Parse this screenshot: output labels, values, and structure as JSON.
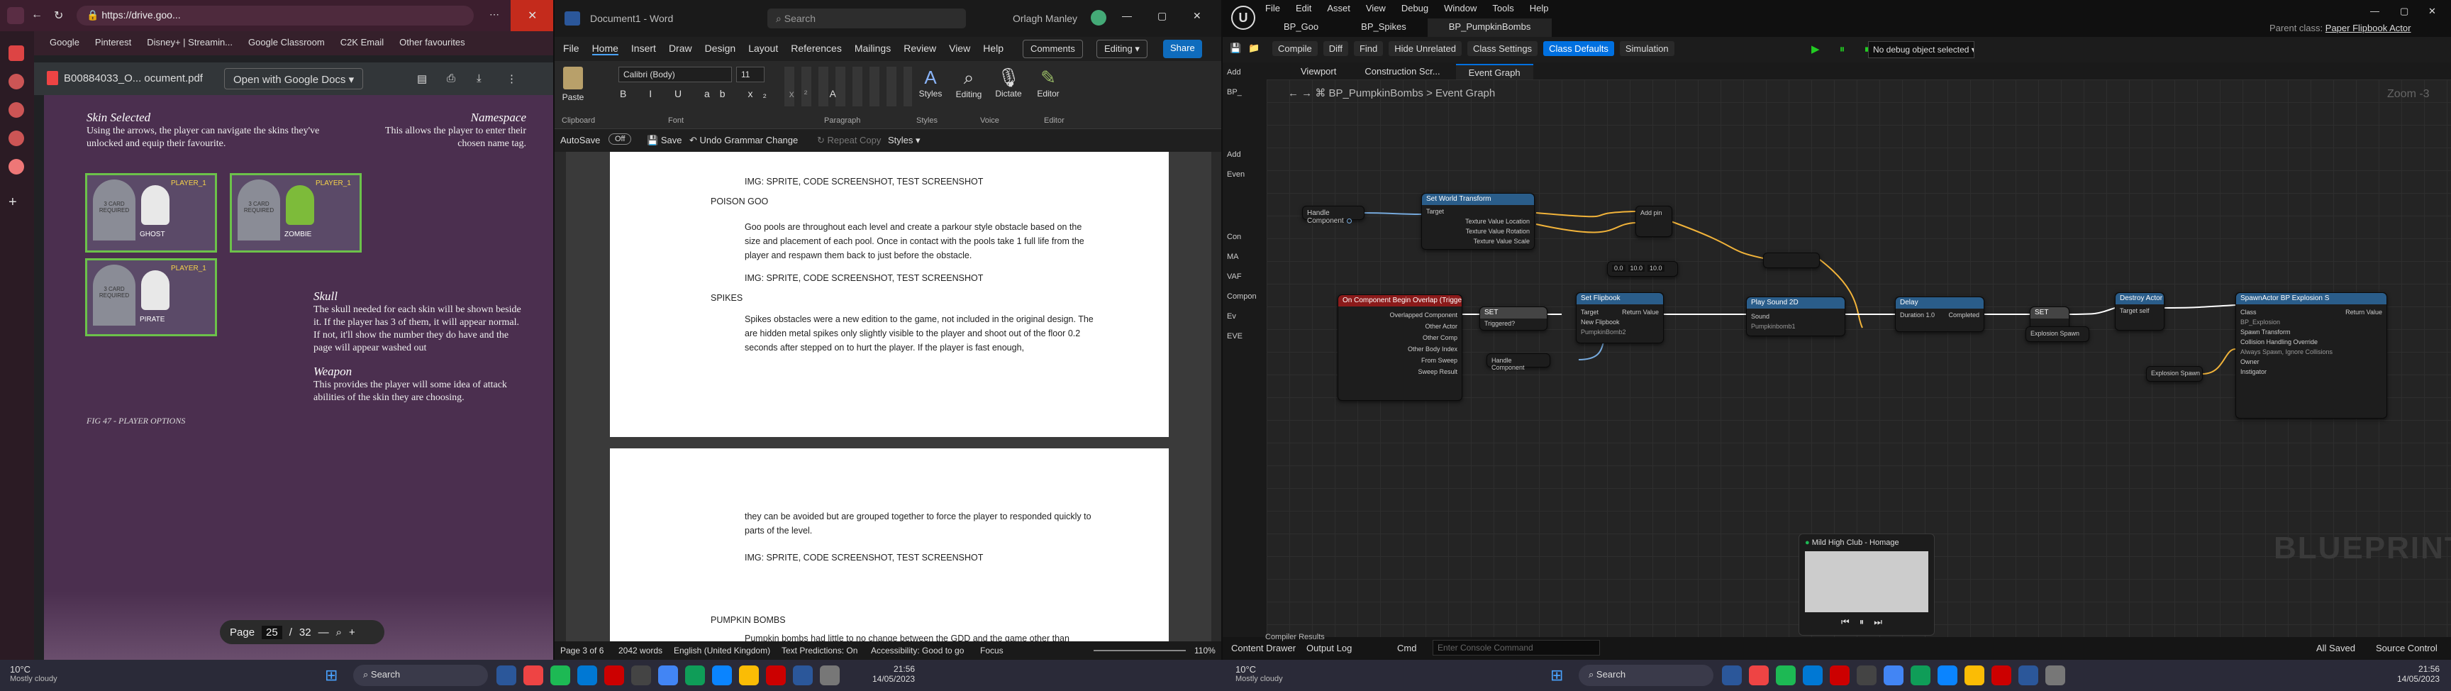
{
  "chrome": {
    "url": "https://drive.goo...",
    "bookmarks": [
      "Google",
      "Pinterest",
      "Disney+ | Streamin...",
      "Google Classroom",
      "C2K Email",
      "Other favourites"
    ],
    "pdf_title": "B00884033_O... ocument.pdf",
    "open_with": "Open with Google Docs",
    "page_label": "Page",
    "page_current": "25",
    "page_sep": "/",
    "page_total": "32",
    "doc": {
      "h1": "Skin Selected",
      "p1": "Using the arrows, the player can navigate the skins they've unlocked and equip their favourite.",
      "h2": "Namespace",
      "p2": "This allows the player to enter their chosen name tag.",
      "h3": "Skull",
      "p3": "The skull needed for each skin will be shown beside it. If the player has 3 of them, it will appear normal. If not, it'll show the number they do have and the page will appear washed out",
      "h4": "Weapon",
      "p4": "This provides the player will some idea of attack abilities of the skin they are choosing.",
      "caption": "FIG 47 - PLAYER OPTIONS",
      "cards": [
        "GHOST",
        "ZOMBIE",
        "PIRATE"
      ],
      "card_player": "PLAYER_1",
      "card_text": "3 CARD REQUIRED"
    }
  },
  "word": {
    "title": "Document1 - Word",
    "search": "Search",
    "user": "Orlagh Manley",
    "menu": [
      "File",
      "Home",
      "Insert",
      "Draw",
      "Design",
      "Layout",
      "References",
      "Mailings",
      "Review",
      "View",
      "Help"
    ],
    "comments": "Comments",
    "editing": "Editing",
    "share": "Share",
    "font": "Calibri (Body)",
    "size": "11",
    "groups": [
      "Clipboard",
      "Font",
      "Paragraph",
      "Styles",
      "Voice",
      "Editor"
    ],
    "big_buttons": [
      "Paste",
      "Styles",
      "Editing",
      "Dictate",
      "Editor"
    ],
    "autosave": "AutoSave",
    "off": "Off",
    "save": "Save",
    "undo": "Undo Grammar Change",
    "repeat": "Repeat Copy",
    "styles_qa": "Styles",
    "page1": [
      "IMG: SPRITE, CODE SCREENSHOT, TEST SCREENSHOT",
      "POISON GOO",
      "Goo pools are throughout each level and create a parkour style obstacle based on the size and placement of each pool. Once in contact with the pools take 1 full life from the player and respawn them back to just before the obstacle.",
      "IMG: SPRITE, CODE SCREENSHOT, TEST SCREENSHOT",
      "SPIKES",
      "Spikes obstacles were a new edition to the game, not included in the original design. The are hidden metal spikes only slightly visible to the player and shoot out of the floor 0.2 seconds after stepped on to hurt the player. If the player is fast enough,"
    ],
    "page2": [
      "they can be avoided but are grouped together to force the player to responded quickly to parts of the level.",
      "IMG: SPRITE, CODE SCREENSHOT, TEST SCREENSHOT",
      "PUMPKIN BOMBS",
      "Pumpkin bombs had little to no change between the GDD and the game other than"
    ],
    "status": {
      "page": "Page 3 of 6",
      "words": "2042 words",
      "lang": "English (United Kingdom)",
      "predict": "Text Predictions: On",
      "access": "Accessibility: Good to go",
      "focus": "Focus",
      "zoom": "110%"
    }
  },
  "ue": {
    "menu": [
      "File",
      "Edit",
      "Asset",
      "View",
      "Debug",
      "Window",
      "Tools",
      "Help"
    ],
    "tabs": [
      "BP_Goo",
      "BP_Spikes",
      "BP_PumpkinBombs"
    ],
    "parent": "Parent class:",
    "parent_val": "Paper Flipbook Actor",
    "toolbar": [
      "Compile",
      "Diff",
      "Find",
      "Hide Unrelated",
      "Class Settings",
      "Class Defaults",
      "Simulation"
    ],
    "debug": "No debug object selected",
    "graph_tabs": [
      "Viewport",
      "Construction Scr...",
      "Event Graph"
    ],
    "breadcrumb": "BP_PumpkinBombs",
    "breadcrumb_sep": ">",
    "breadcrumb_graph": "Event Graph",
    "zoom": "Zoom -3",
    "watermark": "BLUEPRINT",
    "left": [
      "Add",
      "BP_",
      "Add",
      "Even",
      "Con",
      "MA",
      "VAF",
      "Compon",
      "Ev",
      "EVE"
    ],
    "nodes": {
      "set_world": "Set World Transform",
      "on_overlap": "On Component Begin Overlap (Trigger)",
      "set1": "SET",
      "set_flipbook": "Set Flipbook",
      "play_sound": "Play Sound 2D",
      "delay": "Delay",
      "set2": "SET",
      "destroy": "Destroy Actor",
      "spawn": "SpawnActor BP Explosion S",
      "handle": "Handle Component",
      "explosion": "Explosion Spawn",
      "triggered": "Triggered?",
      "add_pin": "Add pin",
      "pins_overlap": [
        "Overlapped Component",
        "Other Actor",
        "Other Comp",
        "Other Body Index",
        "From Sweep",
        "Sweep Result"
      ],
      "pins_world": [
        "Target",
        "Texture Value Location",
        "Texture Value Rotation",
        "Texture Value Scale"
      ],
      "pins_flip": [
        "Target",
        "New Flipbook"
      ],
      "flip_value": "PumpkinBomb2",
      "pin_return": "Return Value",
      "pin_sound": "Sound",
      "sound_value": "Pumpkinbomb1",
      "pin_duration": "Duration",
      "duration": "1.0",
      "pin_completed": "Completed",
      "pin_target": "Target",
      "target_self": "self",
      "pin_class": "Class",
      "spawn_class": "BP_Explosion",
      "spawn_pins": [
        "Spawn Transform",
        "Collision Handling Override",
        "Owner",
        "Instigator"
      ],
      "spawn_collision": "Always Spawn, Ignore Collisions",
      "vector_values": [
        "0.0",
        "10.0",
        "10.0"
      ]
    },
    "music": {
      "app": "Mild High Club - Homage"
    },
    "bottom": [
      "Content Drawer",
      "Output Log",
      "Cmd",
      "Enter Console Command",
      "All Saved",
      "Source Control"
    ],
    "compiler": "Compiler Results"
  },
  "taskbar": {
    "weather_temp": "10°C",
    "weather_desc": "Mostly cloudy",
    "search": "Search",
    "time": "21:56",
    "date": "14/05/2023"
  },
  "colors": {
    "accent": "#0078d4",
    "ue_exec": "#ffffff",
    "event_red": "#8b1a1a",
    "func_blue": "#2a5d8a",
    "chrome_tab": "#3c1e2e"
  }
}
